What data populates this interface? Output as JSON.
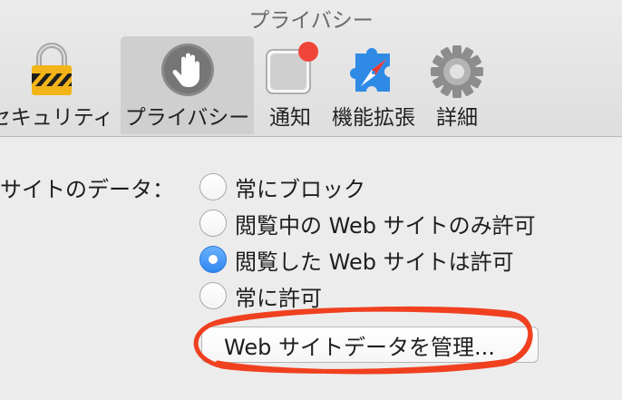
{
  "window": {
    "title": "プライバシー"
  },
  "toolbar": {
    "items": [
      {
        "label": "セキュリティ",
        "icon": "padlock-icon"
      },
      {
        "label": "プライバシー",
        "icon": "hand-icon",
        "selected": true
      },
      {
        "label": "通知",
        "icon": "notification-icon"
      },
      {
        "label": "機能拡張",
        "icon": "extensions-compass-icon"
      },
      {
        "label": "詳細",
        "icon": "gear-icon"
      }
    ]
  },
  "site_data": {
    "label": "サイトのデータ：",
    "options": [
      {
        "label": "常にブロック",
        "checked": false
      },
      {
        "label": "閲覧中の Web サイトのみ許可",
        "checked": false
      },
      {
        "label": "閲覧した Web サイトは許可",
        "checked": true
      },
      {
        "label": "常に許可",
        "checked": false
      }
    ],
    "manage_button": "Web サイトデータを管理..."
  },
  "colors": {
    "annotation": "#f0401f",
    "radio_checked": "#3a8ef0",
    "badge": "#f0453a"
  }
}
